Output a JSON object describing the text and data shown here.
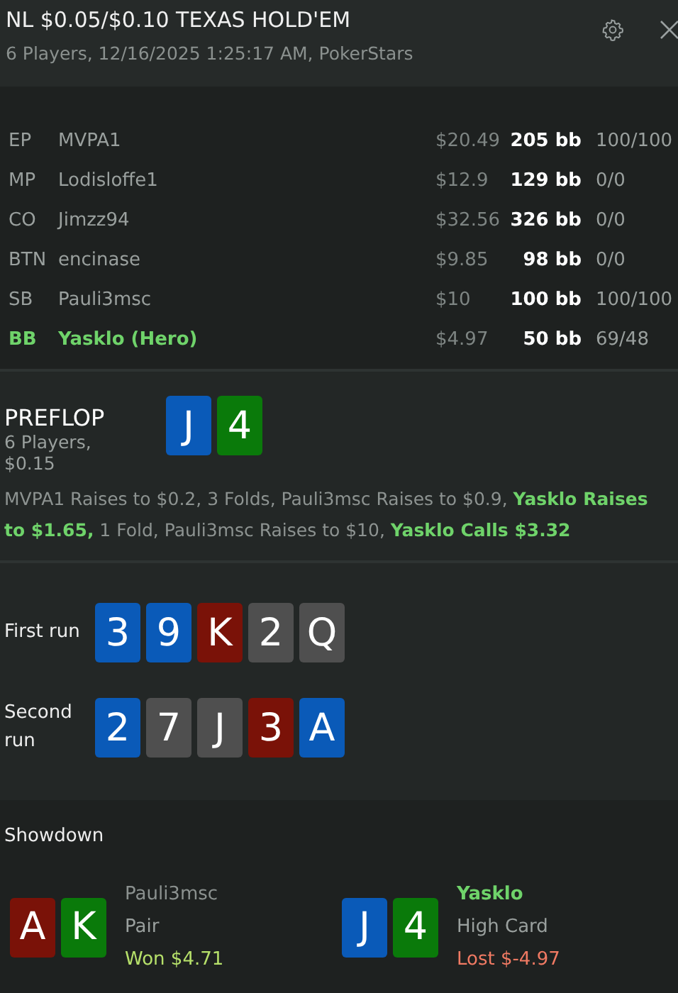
{
  "header": {
    "title": "NL $0.05/$0.10 TEXAS HOLD'EM",
    "subtitle": "6 Players, 12/16/2025 1:25:17 AM, PokerStars"
  },
  "players": [
    {
      "position": "EP",
      "name": "MVPA1",
      "stack": "$20.49",
      "bb": "205 bb",
      "stats": "100/100",
      "hero": false
    },
    {
      "position": "MP",
      "name": "Lodisloffe1",
      "stack": "$12.9",
      "bb": "129 bb",
      "stats": "0/0",
      "hero": false
    },
    {
      "position": "CO",
      "name": "Jimzz94",
      "stack": "$32.56",
      "bb": "326 bb",
      "stats": "0/0",
      "hero": false
    },
    {
      "position": "BTN",
      "name": "encinase",
      "stack": "$9.85",
      "bb": "98 bb",
      "stats": "0/0",
      "hero": false
    },
    {
      "position": "SB",
      "name": "Pauli3msc",
      "stack": "$10",
      "bb": "100 bb",
      "stats": "100/100",
      "hero": false
    },
    {
      "position": "BB",
      "name": "Yasklo (Hero)",
      "stack": "$4.97",
      "bb": "50 bb",
      "stats": "69/48",
      "hero": true
    }
  ],
  "preflop": {
    "title": "PREFLOP",
    "info": "6 Players, $0.15",
    "cards": [
      {
        "rank": "J",
        "color": "#0a5ab8"
      },
      {
        "rank": "4",
        "color": "#0a7a0a"
      }
    ],
    "actions": "MVPA1 Raises to $0.2, 3 Folds, Pauli3msc Raises to $0.9, **Yasklo Raises to $1.65,** 1 Fold, Pauli3msc Raises to $10, **Yasklo Calls $3.32**"
  },
  "runs": [
    {
      "label": "First run",
      "cards": [
        {
          "rank": "3",
          "color": "#0a5ab8"
        },
        {
          "rank": "9",
          "color": "#0a5ab8"
        },
        {
          "rank": "K",
          "color": "#7a1208"
        },
        {
          "rank": "2",
          "color": "#4f4f4f"
        },
        {
          "rank": "Q",
          "color": "#4f4f4f"
        }
      ]
    },
    {
      "label": "Second run",
      "cards": [
        {
          "rank": "2",
          "color": "#0a5ab8"
        },
        {
          "rank": "7",
          "color": "#4f4f4f"
        },
        {
          "rank": "J",
          "color": "#4f4f4f"
        },
        {
          "rank": "3",
          "color": "#7a1208"
        },
        {
          "rank": "A",
          "color": "#0a5ab8"
        }
      ]
    }
  ],
  "showdown": {
    "title": "Showdown",
    "hands": [
      {
        "name": "Pauli3msc",
        "hero": false,
        "hand": "Pair",
        "result": "Won $4.71",
        "kind": "won",
        "cards": [
          {
            "rank": "A",
            "color": "#7a1208"
          },
          {
            "rank": "K",
            "color": "#0a7a0a"
          }
        ]
      },
      {
        "name": "Yasklo",
        "hero": true,
        "hand": "High Card",
        "result": "Lost $-4.97",
        "kind": "lost",
        "cards": [
          {
            "rank": "J",
            "color": "#0a5ab8"
          },
          {
            "rank": "4",
            "color": "#0a7a0a"
          }
        ]
      }
    ]
  }
}
